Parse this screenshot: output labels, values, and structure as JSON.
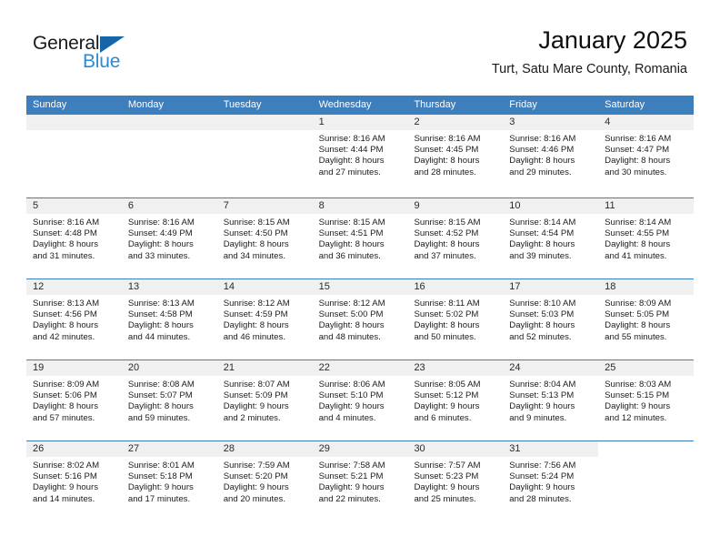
{
  "brand": {
    "name_top": "General",
    "name_bottom": "Blue",
    "accent_color": "#2a8ad4",
    "triangle_color": "#1565a8",
    "triangle_icon": "triangle-icon"
  },
  "header": {
    "title": "January 2025",
    "subtitle": "Turt, Satu Mare County, Romania"
  },
  "calendar": {
    "header_bg": "#3d7ebc",
    "daynum_bg": "#f0f0f0",
    "weekdays": [
      "Sunday",
      "Monday",
      "Tuesday",
      "Wednesday",
      "Thursday",
      "Friday",
      "Saturday"
    ],
    "weeks": [
      [
        {
          "day": "",
          "empty": true,
          "lines": []
        },
        {
          "day": "",
          "empty": true,
          "lines": []
        },
        {
          "day": "",
          "empty": true,
          "lines": []
        },
        {
          "day": "1",
          "lines": [
            "Sunrise: 8:16 AM",
            "Sunset: 4:44 PM",
            "Daylight: 8 hours",
            "and 27 minutes."
          ]
        },
        {
          "day": "2",
          "lines": [
            "Sunrise: 8:16 AM",
            "Sunset: 4:45 PM",
            "Daylight: 8 hours",
            "and 28 minutes."
          ]
        },
        {
          "day": "3",
          "lines": [
            "Sunrise: 8:16 AM",
            "Sunset: 4:46 PM",
            "Daylight: 8 hours",
            "and 29 minutes."
          ]
        },
        {
          "day": "4",
          "lines": [
            "Sunrise: 8:16 AM",
            "Sunset: 4:47 PM",
            "Daylight: 8 hours",
            "and 30 minutes."
          ]
        }
      ],
      [
        {
          "day": "5",
          "lines": [
            "Sunrise: 8:16 AM",
            "Sunset: 4:48 PM",
            "Daylight: 8 hours",
            "and 31 minutes."
          ]
        },
        {
          "day": "6",
          "lines": [
            "Sunrise: 8:16 AM",
            "Sunset: 4:49 PM",
            "Daylight: 8 hours",
            "and 33 minutes."
          ]
        },
        {
          "day": "7",
          "lines": [
            "Sunrise: 8:15 AM",
            "Sunset: 4:50 PM",
            "Daylight: 8 hours",
            "and 34 minutes."
          ]
        },
        {
          "day": "8",
          "lines": [
            "Sunrise: 8:15 AM",
            "Sunset: 4:51 PM",
            "Daylight: 8 hours",
            "and 36 minutes."
          ]
        },
        {
          "day": "9",
          "lines": [
            "Sunrise: 8:15 AM",
            "Sunset: 4:52 PM",
            "Daylight: 8 hours",
            "and 37 minutes."
          ]
        },
        {
          "day": "10",
          "lines": [
            "Sunrise: 8:14 AM",
            "Sunset: 4:54 PM",
            "Daylight: 8 hours",
            "and 39 minutes."
          ]
        },
        {
          "day": "11",
          "lines": [
            "Sunrise: 8:14 AM",
            "Sunset: 4:55 PM",
            "Daylight: 8 hours",
            "and 41 minutes."
          ]
        }
      ],
      [
        {
          "day": "12",
          "lines": [
            "Sunrise: 8:13 AM",
            "Sunset: 4:56 PM",
            "Daylight: 8 hours",
            "and 42 minutes."
          ]
        },
        {
          "day": "13",
          "lines": [
            "Sunrise: 8:13 AM",
            "Sunset: 4:58 PM",
            "Daylight: 8 hours",
            "and 44 minutes."
          ]
        },
        {
          "day": "14",
          "lines": [
            "Sunrise: 8:12 AM",
            "Sunset: 4:59 PM",
            "Daylight: 8 hours",
            "and 46 minutes."
          ]
        },
        {
          "day": "15",
          "lines": [
            "Sunrise: 8:12 AM",
            "Sunset: 5:00 PM",
            "Daylight: 8 hours",
            "and 48 minutes."
          ]
        },
        {
          "day": "16",
          "lines": [
            "Sunrise: 8:11 AM",
            "Sunset: 5:02 PM",
            "Daylight: 8 hours",
            "and 50 minutes."
          ]
        },
        {
          "day": "17",
          "lines": [
            "Sunrise: 8:10 AM",
            "Sunset: 5:03 PM",
            "Daylight: 8 hours",
            "and 52 minutes."
          ]
        },
        {
          "day": "18",
          "lines": [
            "Sunrise: 8:09 AM",
            "Sunset: 5:05 PM",
            "Daylight: 8 hours",
            "and 55 minutes."
          ]
        }
      ],
      [
        {
          "day": "19",
          "lines": [
            "Sunrise: 8:09 AM",
            "Sunset: 5:06 PM",
            "Daylight: 8 hours",
            "and 57 minutes."
          ]
        },
        {
          "day": "20",
          "lines": [
            "Sunrise: 8:08 AM",
            "Sunset: 5:07 PM",
            "Daylight: 8 hours",
            "and 59 minutes."
          ]
        },
        {
          "day": "21",
          "lines": [
            "Sunrise: 8:07 AM",
            "Sunset: 5:09 PM",
            "Daylight: 9 hours",
            "and 2 minutes."
          ]
        },
        {
          "day": "22",
          "lines": [
            "Sunrise: 8:06 AM",
            "Sunset: 5:10 PM",
            "Daylight: 9 hours",
            "and 4 minutes."
          ]
        },
        {
          "day": "23",
          "lines": [
            "Sunrise: 8:05 AM",
            "Sunset: 5:12 PM",
            "Daylight: 9 hours",
            "and 6 minutes."
          ]
        },
        {
          "day": "24",
          "lines": [
            "Sunrise: 8:04 AM",
            "Sunset: 5:13 PM",
            "Daylight: 9 hours",
            "and 9 minutes."
          ]
        },
        {
          "day": "25",
          "lines": [
            "Sunrise: 8:03 AM",
            "Sunset: 5:15 PM",
            "Daylight: 9 hours",
            "and 12 minutes."
          ]
        }
      ],
      [
        {
          "day": "26",
          "lines": [
            "Sunrise: 8:02 AM",
            "Sunset: 5:16 PM",
            "Daylight: 9 hours",
            "and 14 minutes."
          ]
        },
        {
          "day": "27",
          "lines": [
            "Sunrise: 8:01 AM",
            "Sunset: 5:18 PM",
            "Daylight: 9 hours",
            "and 17 minutes."
          ]
        },
        {
          "day": "28",
          "lines": [
            "Sunrise: 7:59 AM",
            "Sunset: 5:20 PM",
            "Daylight: 9 hours",
            "and 20 minutes."
          ]
        },
        {
          "day": "29",
          "lines": [
            "Sunrise: 7:58 AM",
            "Sunset: 5:21 PM",
            "Daylight: 9 hours",
            "and 22 minutes."
          ]
        },
        {
          "day": "30",
          "lines": [
            "Sunrise: 7:57 AM",
            "Sunset: 5:23 PM",
            "Daylight: 9 hours",
            "and 25 minutes."
          ]
        },
        {
          "day": "31",
          "lines": [
            "Sunrise: 7:56 AM",
            "Sunset: 5:24 PM",
            "Daylight: 9 hours",
            "and 28 minutes."
          ]
        },
        {
          "day": "",
          "blank": true,
          "lines": []
        }
      ]
    ]
  }
}
